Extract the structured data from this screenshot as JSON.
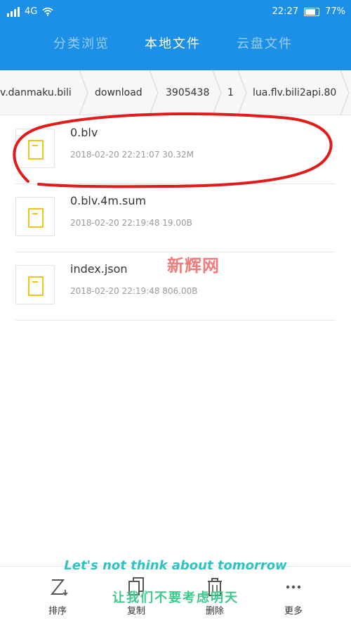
{
  "status": {
    "network": "4G",
    "time": "22:27",
    "battery": "77%",
    "battery_level": 0.77
  },
  "tabs": [
    {
      "label": "分类浏览",
      "active": false
    },
    {
      "label": "本地文件",
      "active": true
    },
    {
      "label": "云盘文件",
      "active": false
    }
  ],
  "breadcrumb": [
    "v.danmaku.bili",
    "download",
    "3905438",
    "1",
    "lua.flv.bili2api.80"
  ],
  "files": [
    {
      "name": "0.blv",
      "meta": "2018-02-20 22:21:07 30.32M"
    },
    {
      "name": "0.blv.4m.sum",
      "meta": "2018-02-20 22:19:48 19.00B"
    },
    {
      "name": "index.json",
      "meta": "2018-02-20 22:19:48 806.00B"
    }
  ],
  "watermark": "新辉网",
  "subtitle": {
    "en": "Let's not think about tomorrow",
    "zh": "让我们不要考虑明天"
  },
  "toolbar": [
    {
      "label": "排序",
      "icon": "sort-icon"
    },
    {
      "label": "复制",
      "icon": "copy-icon"
    },
    {
      "label": "删除",
      "icon": "delete-icon"
    },
    {
      "label": "更多",
      "icon": "more-icon"
    }
  ],
  "colors": {
    "header": "#1c8fe6",
    "file_icon": "#f0c419",
    "annotation": "#e11a1a"
  }
}
